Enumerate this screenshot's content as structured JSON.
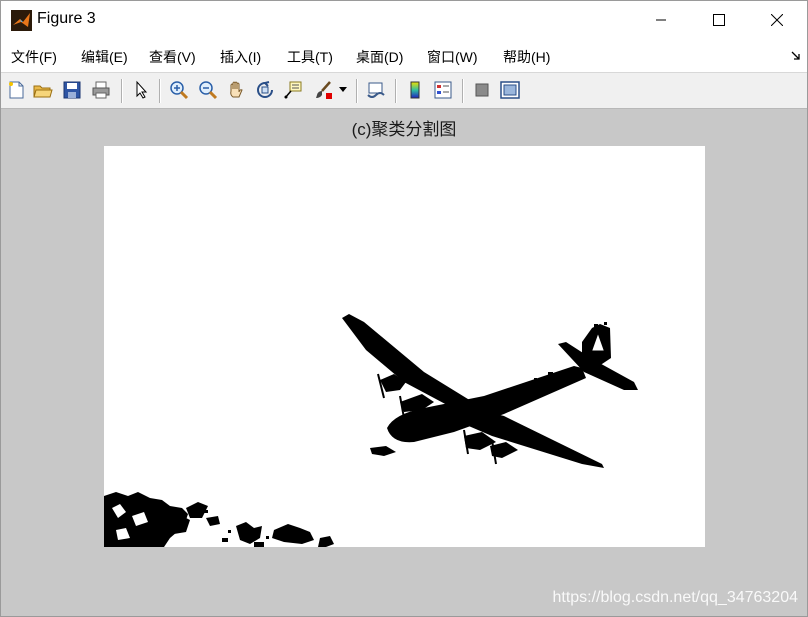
{
  "window": {
    "title": "Figure 3",
    "controls": [
      "minimize",
      "maximize",
      "close"
    ]
  },
  "menu": [
    {
      "label": "文件(F)"
    },
    {
      "label": "编辑(E)"
    },
    {
      "label": "查看(V)"
    },
    {
      "label": "插入(I)"
    },
    {
      "label": "工具(T)"
    },
    {
      "label": "桌面(D)"
    },
    {
      "label": "窗口(W)"
    },
    {
      "label": "帮助(H)"
    }
  ],
  "toolbar": {
    "icons": [
      "new-figure-icon",
      "open-file-icon",
      "save-icon",
      "print-icon",
      "select-arrow-icon",
      "zoom-in-icon",
      "zoom-out-icon",
      "pan-hand-icon",
      "rotate-3d-icon",
      "data-cursor-icon",
      "brush-icon",
      "brush-dropdown-icon",
      "link-plot-icon",
      "colorbar-icon",
      "legend-icon",
      "hide-plot-tools-icon",
      "show-plot-tools-icon"
    ]
  },
  "axes": {
    "title": "(c)聚类分割图"
  },
  "watermark": "https://blog.csdn.net/qq_34763204",
  "colors": {
    "figure_bg": "#c8c8c8",
    "image_fg": "#000000",
    "image_bg": "#ffffff"
  }
}
